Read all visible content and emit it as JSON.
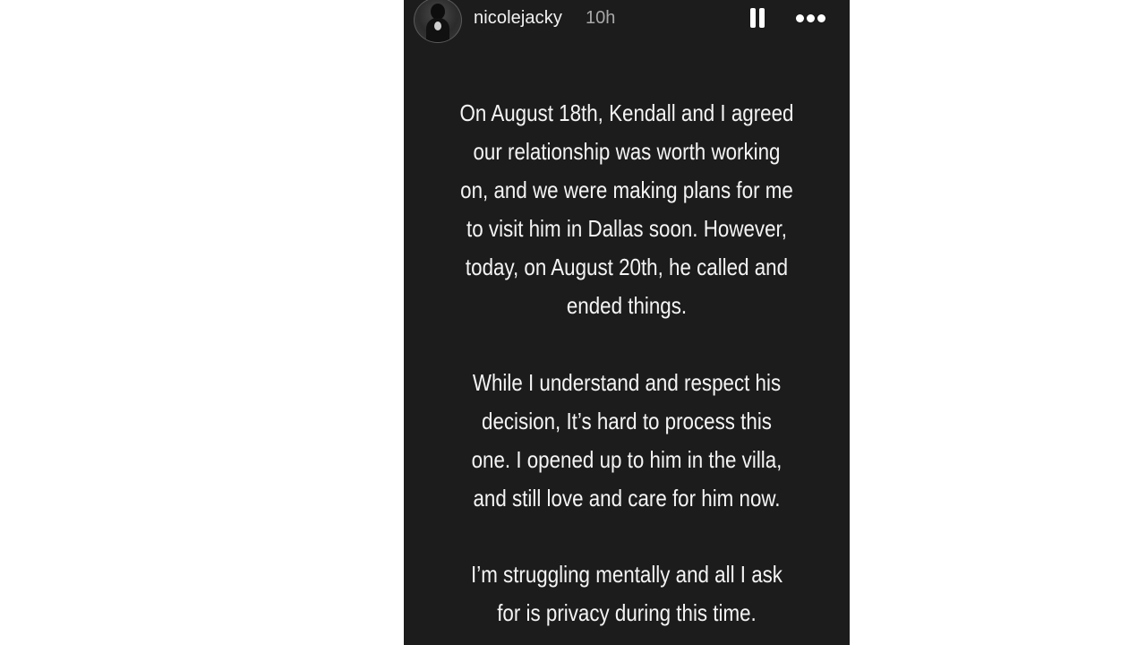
{
  "story": {
    "username": "nicolejacky",
    "time_ago": "10h",
    "paragraphs": [
      {
        "lines": [
          "On August 18th, Kendall and I agreed",
          "our relationship was worth working",
          "on, and we were making plans for me",
          "to visit him in Dallas soon. However,",
          "today, on August 20th, he called and",
          "ended things."
        ]
      },
      {
        "lines": [
          "While I understand and respect his",
          "decision, It’s hard to process this",
          "one. I opened up to him in the villa,",
          "and still love and care for him now."
        ]
      },
      {
        "lines": [
          "I’m struggling mentally and all I ask",
          "for is privacy during this time."
        ]
      }
    ]
  },
  "icons": {
    "pause": "pause-icon",
    "more": "more-horizontal-icon",
    "avatar": "profile-avatar"
  },
  "colors": {
    "story_background": "#1c1c1c",
    "page_background": "#ffffff",
    "text": "#f4f4f4",
    "time_text": "#a8a8a8"
  }
}
